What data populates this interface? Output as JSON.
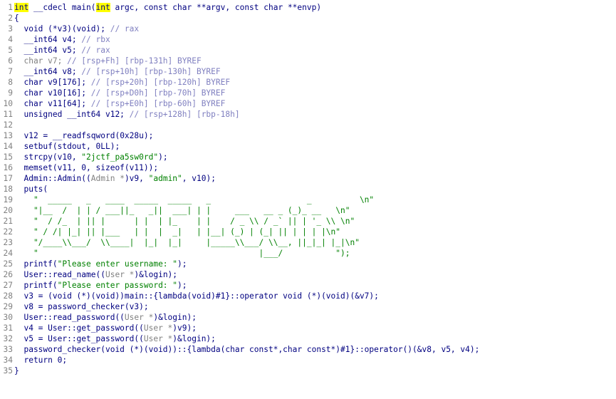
{
  "code": {
    "lines": [
      {
        "n": "1",
        "tokens": [
          {
            "t": "int",
            "c": "kw hl"
          },
          {
            "t": " __cdecl main(",
            "c": "kw"
          },
          {
            "t": "int",
            "c": "kw hl"
          },
          {
            "t": " argc, const char **argv, const char **envp)",
            "c": "kw"
          }
        ]
      },
      {
        "n": "2",
        "tokens": [
          {
            "t": "{",
            "c": "kw"
          }
        ]
      },
      {
        "n": "3",
        "tokens": [
          {
            "t": "  void (*v3)(void); ",
            "c": "kw"
          },
          {
            "t": "// rax",
            "c": "cm"
          }
        ]
      },
      {
        "n": "4",
        "tokens": [
          {
            "t": "  __int64 v4; ",
            "c": "kw"
          },
          {
            "t": "// rbx",
            "c": "cm"
          }
        ]
      },
      {
        "n": "5",
        "tokens": [
          {
            "t": "  __int64 v5; ",
            "c": "kw"
          },
          {
            "t": "// rax",
            "c": "cm"
          }
        ]
      },
      {
        "n": "6",
        "tokens": [
          {
            "t": "  char v7; ",
            "c": "gray"
          },
          {
            "t": "// [rsp+Fh] [rbp-131h] BYREF",
            "c": "cm"
          }
        ]
      },
      {
        "n": "7",
        "tokens": [
          {
            "t": "  __int64 v8; ",
            "c": "kw"
          },
          {
            "t": "// [rsp+10h] [rbp-130h] BYREF",
            "c": "cm"
          }
        ]
      },
      {
        "n": "8",
        "tokens": [
          {
            "t": "  char v9[176]; ",
            "c": "kw"
          },
          {
            "t": "// [rsp+20h] [rbp-120h] BYREF",
            "c": "cm"
          }
        ]
      },
      {
        "n": "9",
        "tokens": [
          {
            "t": "  char v10[16]; ",
            "c": "kw"
          },
          {
            "t": "// [rsp+D0h] [rbp-70h] BYREF",
            "c": "cm"
          }
        ]
      },
      {
        "n": "10",
        "tokens": [
          {
            "t": "  char v11[64]; ",
            "c": "kw"
          },
          {
            "t": "// [rsp+E0h] [rbp-60h] BYREF",
            "c": "cm"
          }
        ]
      },
      {
        "n": "11",
        "tokens": [
          {
            "t": "  unsigned __int64 v12; ",
            "c": "kw"
          },
          {
            "t": "// [rsp+128h] [rbp-18h]",
            "c": "cm"
          }
        ]
      },
      {
        "n": "12",
        "tokens": [
          {
            "t": "",
            "c": "kw"
          }
        ]
      },
      {
        "n": "13",
        "tokens": [
          {
            "t": "  v12 = __readfsqword(",
            "c": "kw"
          },
          {
            "t": "0x28u",
            "c": "kw"
          },
          {
            "t": ");",
            "c": "kw"
          }
        ]
      },
      {
        "n": "14",
        "tokens": [
          {
            "t": "  setbuf(stdout, 0LL);",
            "c": "kw"
          }
        ]
      },
      {
        "n": "15",
        "tokens": [
          {
            "t": "  strcpy(v10, ",
            "c": "kw"
          },
          {
            "t": "\"2jctf_pa5sw0rd\"",
            "c": "str"
          },
          {
            "t": ");",
            "c": "kw"
          }
        ]
      },
      {
        "n": "16",
        "tokens": [
          {
            "t": "  memset(v11, 0, sizeof(v11));",
            "c": "kw"
          }
        ]
      },
      {
        "n": "17",
        "tokens": [
          {
            "t": "  Admin::Admin((",
            "c": "kw"
          },
          {
            "t": "Admin *",
            "c": "gray"
          },
          {
            "t": ")v9, ",
            "c": "kw"
          },
          {
            "t": "\"admin\"",
            "c": "str"
          },
          {
            "t": ", v10);",
            "c": "kw"
          }
        ]
      },
      {
        "n": "18",
        "tokens": [
          {
            "t": "  puts(",
            "c": "kw"
          }
        ]
      },
      {
        "n": "19",
        "tokens": [
          {
            "t": "    \"  _____   _   ____  _____  _____   _                    _          \\n\"",
            "c": "str"
          }
        ]
      },
      {
        "n": "20",
        "tokens": [
          {
            "t": "    \"|__  /  | | / ___||_   _||  ___| | |     ___   __ _ (_)_ __   \\n\"",
            "c": "str"
          }
        ]
      },
      {
        "n": "21",
        "tokens": [
          {
            "t": "    \"  / /_  | || |      | |  | |_    | |    / _ \\\\ / _` || | '_ \\\\ \\n\"",
            "c": "str"
          }
        ]
      },
      {
        "n": "22",
        "tokens": [
          {
            "t": "    \" / /| |_| || |___   | |  |  _|   | |__| (_) | (_| || | | | |\\n\"",
            "c": "str"
          }
        ]
      },
      {
        "n": "23",
        "tokens": [
          {
            "t": "    \"/____\\\\___/  \\\\____|  |_|  |_|     |_____\\\\___/ \\\\__, ||_|_| |_|\\n\"",
            "c": "str"
          }
        ]
      },
      {
        "n": "24",
        "tokens": [
          {
            "t": "    \"                                              |___/           \");",
            "c": "str"
          }
        ]
      },
      {
        "n": "25",
        "tokens": [
          {
            "t": "  printf(",
            "c": "kw"
          },
          {
            "t": "\"Please enter username: \"",
            "c": "str"
          },
          {
            "t": ");",
            "c": "kw"
          }
        ]
      },
      {
        "n": "26",
        "tokens": [
          {
            "t": "  User::read_name((",
            "c": "kw"
          },
          {
            "t": "User *",
            "c": "gray"
          },
          {
            "t": ")&login);",
            "c": "kw"
          }
        ]
      },
      {
        "n": "27",
        "tokens": [
          {
            "t": "  printf(",
            "c": "kw"
          },
          {
            "t": "\"Please enter password: \"",
            "c": "str"
          },
          {
            "t": ");",
            "c": "kw"
          }
        ]
      },
      {
        "n": "28",
        "tokens": [
          {
            "t": "  v3 = (void (*)(void))main::{lambda(void)#1}::operator void (*)(void)(&v7);",
            "c": "kw"
          }
        ]
      },
      {
        "n": "29",
        "tokens": [
          {
            "t": "  v8 = password_checker(v3);",
            "c": "kw"
          }
        ]
      },
      {
        "n": "30",
        "tokens": [
          {
            "t": "  User::read_password((",
            "c": "kw"
          },
          {
            "t": "User *",
            "c": "gray"
          },
          {
            "t": ")&login);",
            "c": "kw"
          }
        ]
      },
      {
        "n": "31",
        "tokens": [
          {
            "t": "  v4 = User::get_password((",
            "c": "kw"
          },
          {
            "t": "User *",
            "c": "gray"
          },
          {
            "t": ")v9);",
            "c": "kw"
          }
        ]
      },
      {
        "n": "32",
        "tokens": [
          {
            "t": "  v5 = User::get_password((",
            "c": "kw"
          },
          {
            "t": "User *",
            "c": "gray"
          },
          {
            "t": ")&login);",
            "c": "kw"
          }
        ]
      },
      {
        "n": "33",
        "tokens": [
          {
            "t": "  password_checker(void (*)(void))::{lambda(char const*,char const*)#1}::operator()(&v8, v5, v4);",
            "c": "kw"
          }
        ]
      },
      {
        "n": "34",
        "tokens": [
          {
            "t": "  return 0;",
            "c": "kw"
          }
        ]
      },
      {
        "n": "35",
        "tokens": [
          {
            "t": "}",
            "c": "kw"
          }
        ]
      }
    ]
  },
  "colors": {
    "keyword": "#000080",
    "comment": "#8080c0",
    "string": "#008000",
    "gutter": "#808080",
    "highlight": "#ffff00"
  }
}
